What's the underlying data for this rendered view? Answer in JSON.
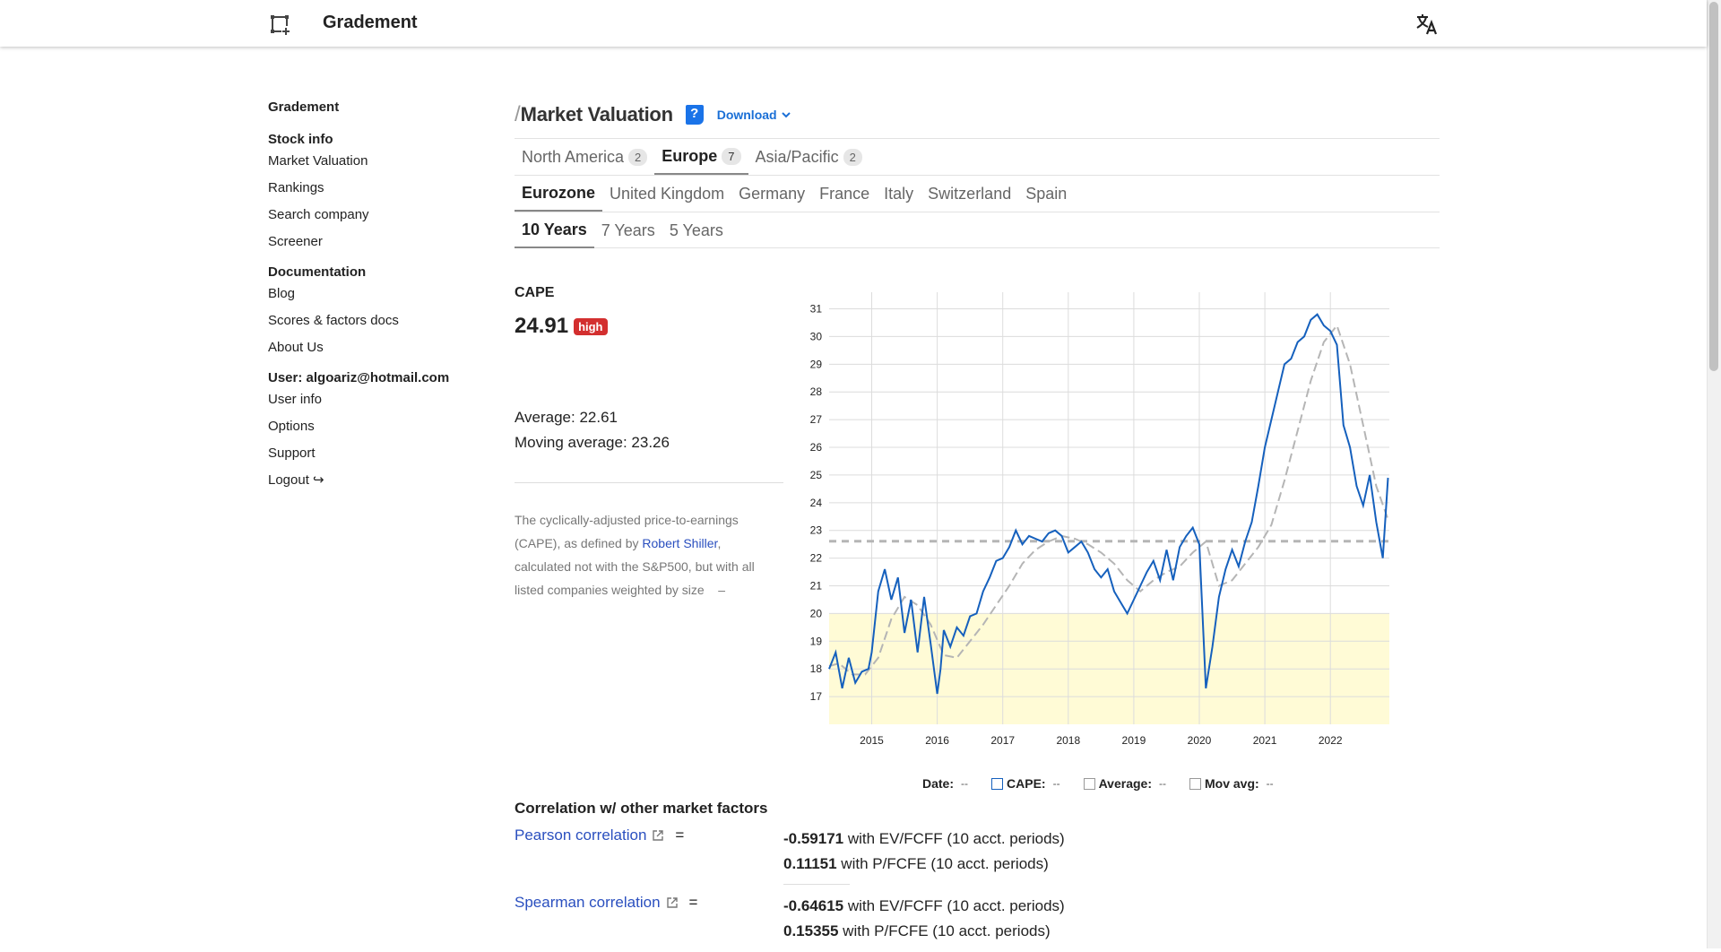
{
  "app": {
    "title": "Gradement"
  },
  "sidebar": {
    "brand": "Gradement",
    "sections": [
      {
        "heading": "Stock info",
        "items": [
          "Market Valuation",
          "Rankings",
          "Search company",
          "Screener"
        ]
      },
      {
        "heading": "Documentation",
        "items": [
          "Blog",
          "Scores & factors docs",
          "About Us"
        ]
      },
      {
        "heading": "User: algoariz@hotmail.com",
        "items": [
          "User info",
          "Options",
          "Support",
          "Logout ↪"
        ]
      }
    ]
  },
  "page": {
    "slash": "/",
    "title": "Market Valuation",
    "help_label": "?",
    "download_label": "Download",
    "region_tabs": [
      {
        "label": "North America",
        "count": "2",
        "active": false
      },
      {
        "label": "Europe",
        "count": "7",
        "active": true
      },
      {
        "label": "Asia/Pacific",
        "count": "2",
        "active": false
      }
    ],
    "market_tabs": [
      "Eurozone",
      "United Kingdom",
      "Germany",
      "France",
      "Italy",
      "Switzerland",
      "Spain"
    ],
    "period_tabs": [
      "10 Years",
      "7 Years",
      "5 Years"
    ]
  },
  "metric": {
    "label": "CAPE",
    "value": "24.91",
    "badge": "high",
    "average": "Average: 22.61",
    "moving_average": "Moving average: 23.26",
    "desc_part1": "The cyclically-adjusted price-to-earnings (CAPE), as defined by ",
    "desc_link": "Robert Shiller",
    "desc_part2": ", calculated not with the S&P500, but with all listed companies weighted by size",
    "desc_toggle": "–"
  },
  "legend": {
    "date_label": "Date:",
    "date_value": "--",
    "cape_label": "CAPE:",
    "cape_value": "--",
    "avg_label": "Average:",
    "avg_value": "--",
    "mov_label": "Mov avg:",
    "mov_value": "--"
  },
  "correlation": {
    "title": "Correlation w/ other market factors",
    "rows": [
      {
        "name": "Pearson correlation",
        "eq": "=",
        "v1": "-0.59171",
        "t1": " with EV/FCFF (10 acct. periods)",
        "v2": "0.11151",
        "t2": " with P/FCFE (10 acct. periods)"
      },
      {
        "name": "Spearman correlation",
        "eq": "=",
        "v1": "-0.64615",
        "t1": " with EV/FCFF (10 acct. periods)",
        "v2": "0.15355",
        "t2": " with P/FCFE (10 acct. periods)"
      }
    ]
  },
  "colors": {
    "cape_line": "#1560bd",
    "mov_avg_line": "#b5b5b5",
    "average_line": "#b5b5b5",
    "low_zone": "#fffbd6",
    "badge_high": "#d32f2f"
  },
  "chart_data": {
    "type": "line",
    "xlabel": "",
    "ylabel": "",
    "xlim": [
      2014.35,
      2022.9
    ],
    "ylim": [
      16,
      31.6
    ],
    "x_ticks": [
      "2015",
      "2016",
      "2017",
      "2018",
      "2019",
      "2020",
      "2021",
      "2022"
    ],
    "y_ticks": [
      17,
      18,
      19,
      20,
      21,
      22,
      23,
      24,
      25,
      26,
      27,
      28,
      29,
      30,
      31
    ],
    "grid": true,
    "low_zone_max": 20,
    "average": 22.61,
    "series": [
      {
        "name": "CAPE",
        "x": [
          2014.35,
          2014.45,
          2014.55,
          2014.65,
          2014.75,
          2014.85,
          2014.95,
          2015.0,
          2015.1,
          2015.2,
          2015.3,
          2015.4,
          2015.5,
          2015.6,
          2015.7,
          2015.8,
          2015.9,
          2016.0,
          2016.05,
          2016.1,
          2016.2,
          2016.3,
          2016.4,
          2016.5,
          2016.6,
          2016.7,
          2016.8,
          2016.9,
          2017.0,
          2017.1,
          2017.2,
          2017.3,
          2017.4,
          2017.5,
          2017.6,
          2017.7,
          2017.8,
          2017.9,
          2018.0,
          2018.1,
          2018.2,
          2018.3,
          2018.4,
          2018.5,
          2018.6,
          2018.7,
          2018.8,
          2018.9,
          2019.0,
          2019.1,
          2019.2,
          2019.3,
          2019.4,
          2019.5,
          2019.6,
          2019.7,
          2019.8,
          2019.9,
          2020.0,
          2020.1,
          2020.2,
          2020.3,
          2020.4,
          2020.5,
          2020.6,
          2020.7,
          2020.8,
          2020.9,
          2021.0,
          2021.1,
          2021.2,
          2021.3,
          2021.4,
          2021.5,
          2021.6,
          2021.7,
          2021.8,
          2021.9,
          2022.0,
          2022.1,
          2022.2,
          2022.3,
          2022.4,
          2022.5,
          2022.6,
          2022.7,
          2022.8,
          2022.88
        ],
        "y": [
          18.0,
          18.6,
          17.3,
          18.4,
          17.5,
          17.9,
          18.0,
          18.6,
          20.8,
          21.6,
          20.5,
          21.3,
          19.3,
          20.5,
          18.6,
          20.6,
          18.9,
          17.1,
          18.0,
          19.4,
          18.8,
          19.5,
          19.2,
          19.9,
          20.0,
          20.8,
          21.3,
          21.9,
          22.0,
          22.4,
          23.0,
          22.5,
          22.8,
          22.7,
          22.6,
          22.9,
          23.0,
          22.8,
          22.2,
          22.4,
          22.6,
          22.2,
          21.6,
          21.3,
          21.6,
          20.8,
          20.4,
          20.0,
          20.5,
          21.0,
          21.5,
          21.9,
          21.2,
          22.3,
          21.2,
          22.4,
          22.8,
          23.1,
          22.5,
          17.3,
          18.8,
          20.6,
          21.6,
          22.3,
          21.7,
          22.6,
          23.3,
          24.6,
          26.0,
          27.0,
          28.0,
          29.0,
          29.2,
          29.8,
          30.0,
          30.6,
          30.8,
          30.4,
          30.2,
          29.7,
          26.8,
          26.0,
          24.6,
          23.9,
          25.0,
          23.3,
          22.0,
          24.9
        ]
      },
      {
        "name": "Mov avg",
        "x": [
          2014.35,
          2014.5,
          2014.7,
          2014.9,
          2015.1,
          2015.3,
          2015.5,
          2015.7,
          2015.9,
          2016.1,
          2016.3,
          2016.5,
          2016.7,
          2016.9,
          2017.1,
          2017.3,
          2017.5,
          2017.7,
          2017.9,
          2018.1,
          2018.3,
          2018.5,
          2018.7,
          2018.9,
          2019.1,
          2019.3,
          2019.5,
          2019.7,
          2019.9,
          2020.1,
          2020.3,
          2020.5,
          2020.7,
          2020.9,
          2021.1,
          2021.3,
          2021.5,
          2021.7,
          2021.9,
          2022.1,
          2022.3,
          2022.5,
          2022.7,
          2022.88
        ],
        "y": [
          18.1,
          18.2,
          17.8,
          17.8,
          18.4,
          19.8,
          20.6,
          20.3,
          19.6,
          18.5,
          18.4,
          19.0,
          19.6,
          20.3,
          21.0,
          21.8,
          22.3,
          22.6,
          22.8,
          22.7,
          22.5,
          22.2,
          21.8,
          21.2,
          20.8,
          21.2,
          21.5,
          21.7,
          22.2,
          22.6,
          21.0,
          21.2,
          21.8,
          22.4,
          23.2,
          24.8,
          26.6,
          28.4,
          29.8,
          30.4,
          29.0,
          26.8,
          24.6,
          23.4
        ]
      }
    ]
  }
}
